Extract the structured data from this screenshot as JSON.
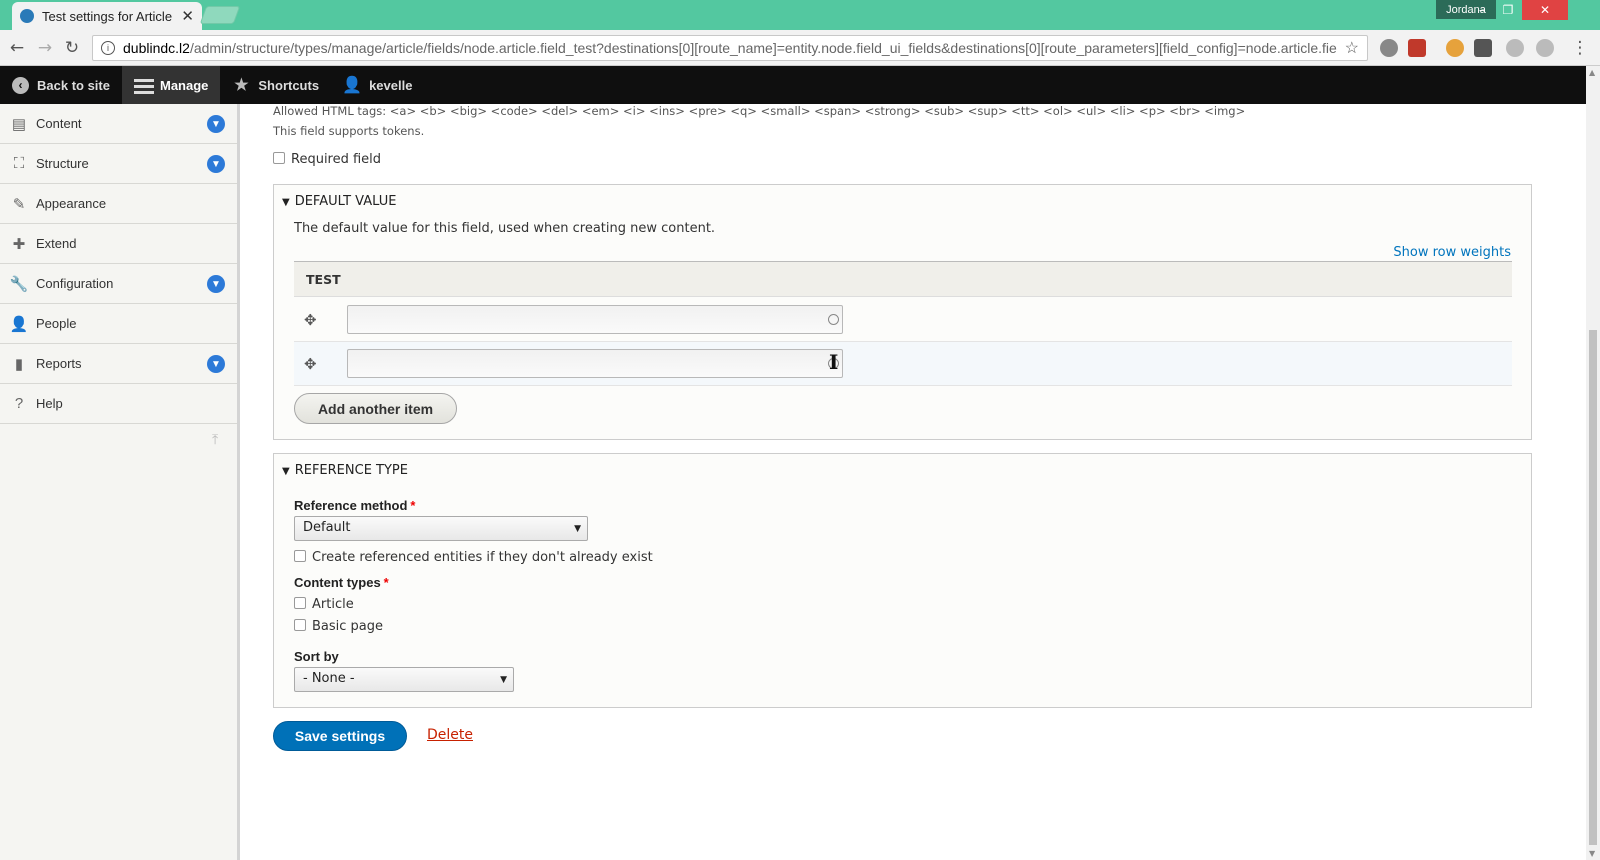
{
  "browser": {
    "tab_title": "Test settings for Article |",
    "profile_name": "Jordana",
    "url_host": "dublindc.l2",
    "url_path": "/admin/structure/types/manage/article/fields/node.article.field_test?destinations[0][route_name]=entity.node.field_ui_fields&destinations[0][route_parameters][field_config]=node.article.fie"
  },
  "toolbar": {
    "back_to_site": "Back to site",
    "manage": "Manage",
    "shortcuts": "Shortcuts",
    "user": "kevelle"
  },
  "sidebar": {
    "items": [
      {
        "label": "Content",
        "icon": "file-icon",
        "expandable": true
      },
      {
        "label": "Structure",
        "icon": "sitemap-icon",
        "expandable": true
      },
      {
        "label": "Appearance",
        "icon": "paintbrush-icon",
        "expandable": false
      },
      {
        "label": "Extend",
        "icon": "puzzle-icon",
        "expandable": false
      },
      {
        "label": "Configuration",
        "icon": "wrench-icon",
        "expandable": true
      },
      {
        "label": "People",
        "icon": "person-icon",
        "expandable": false
      },
      {
        "label": "Reports",
        "icon": "bar-chart-icon",
        "expandable": true
      },
      {
        "label": "Help",
        "icon": "question-icon",
        "expandable": false
      }
    ]
  },
  "form": {
    "allowed_html": "Allowed HTML tags: <a> <b> <big> <code> <del> <em> <i> <ins> <pre> <q> <small> <span> <strong> <sub> <sup> <tt> <ol> <ul> <li> <p> <br> <img>",
    "tokens_note": "This field supports tokens.",
    "required_field_label": "Required field",
    "default_value": {
      "legend": "DEFAULT VALUE",
      "description": "The default value for this field, used when creating new content.",
      "show_row_weights": "Show row weights",
      "table_header": "TEST",
      "rows": [
        "",
        ""
      ],
      "add_another_item": "Add another item"
    },
    "reference_type": {
      "legend": "REFERENCE TYPE",
      "reference_method_label": "Reference method",
      "reference_method_value": "Default",
      "create_referenced_label": "Create referenced entities if they don't already exist",
      "content_types_label": "Content types",
      "content_types": [
        "Article",
        "Basic page"
      ],
      "sort_by_label": "Sort by",
      "sort_by_value": "- None -"
    },
    "save_settings": "Save settings",
    "delete": "Delete"
  },
  "colors": {
    "tabbar": "#53c8a0",
    "primary_button": "#0071b8",
    "link": "#0074bd",
    "delete": "#c72100",
    "toggle": "#2d7ad8"
  }
}
